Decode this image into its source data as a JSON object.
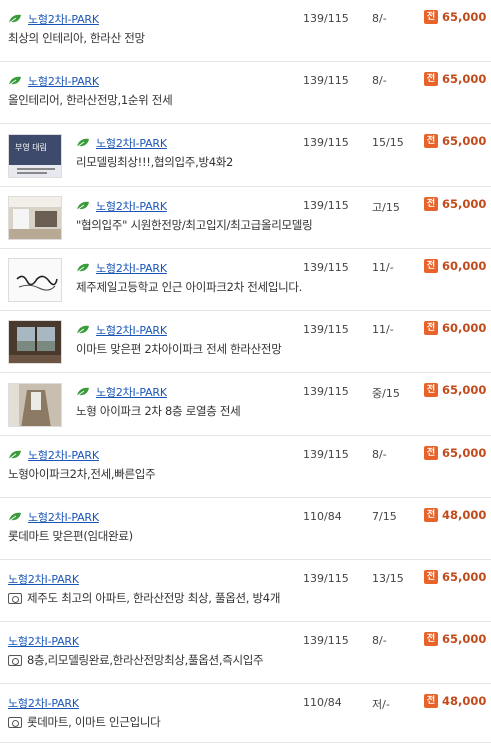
{
  "colors": {
    "link": "#1a56b8",
    "price": "#c24a1b",
    "badge": "#e8632a",
    "leaf": "#3a9b3a"
  },
  "badge_label": "전",
  "listings": [
    {
      "apt": "노형2차I-PARK",
      "desc": "최상의 인테리아, 한라산 전망",
      "area": "139/115",
      "floor": "8/-",
      "price": "65,000",
      "icon": "leaf-icon",
      "thumb": null,
      "photo_icon": false
    },
    {
      "apt": "노형2차I-PARK",
      "desc": "올인테리어, 한라산전망,1순위 전세",
      "area": "139/115",
      "floor": "8/-",
      "price": "65,000",
      "icon": "leaf-icon",
      "thumb": null,
      "photo_icon": false
    },
    {
      "apt": "노형2차I-PARK",
      "desc": "리모델링최상!!!,협의입주,방4화2",
      "area": "139/115",
      "floor": "15/15",
      "price": "65,000",
      "icon": "leaf-icon",
      "thumb": "office-sign",
      "thumb_text": "부영 대림",
      "photo_icon": false
    },
    {
      "apt": "노형2차I-PARK",
      "desc": "\"협의입주\" 시원한전망/최고입지/최고급올리모델링",
      "area": "139/115",
      "floor": "고/15",
      "price": "65,000",
      "icon": "leaf-icon",
      "thumb": "living-room",
      "photo_icon": false
    },
    {
      "apt": "노형2차I-PARK",
      "desc": "제주제일고등학교 인근 아이파크2차 전세입니다.",
      "area": "139/115",
      "floor": "11/-",
      "price": "60,000",
      "icon": "leaf-icon",
      "thumb": "calligraphy",
      "photo_icon": false
    },
    {
      "apt": "노형2차I-PARK",
      "desc": "이마트 맞은편 2차아이파크 전세 한라산전망",
      "area": "139/115",
      "floor": "11/-",
      "price": "60,000",
      "icon": "leaf-icon",
      "thumb": "window-view",
      "photo_icon": false
    },
    {
      "apt": "노형2차I-PARK",
      "desc": "노형 아이파크 2차 8층 로열층 전세",
      "area": "139/115",
      "floor": "중/15",
      "price": "65,000",
      "icon": "leaf-icon",
      "thumb": "hallway",
      "photo_icon": false
    },
    {
      "apt": "노형2차I-PARK",
      "desc": "노형아이파크2차,전세,빠른입주",
      "area": "139/115",
      "floor": "8/-",
      "price": "65,000",
      "icon": "leaf-icon",
      "thumb": null,
      "photo_icon": false
    },
    {
      "apt": "노형2차I-PARK",
      "desc": "롯데마트 맞은편(임대완료)",
      "area": "110/84",
      "floor": "7/15",
      "price": "48,000",
      "icon": "leaf-icon",
      "thumb": null,
      "photo_icon": false
    },
    {
      "apt": "노형2차I-PARK",
      "desc": "제주도 최고의 아파트, 한라산전망 최상, 풀옵션, 방4개",
      "area": "139/115",
      "floor": "13/15",
      "price": "65,000",
      "icon": null,
      "thumb": null,
      "photo_icon": true
    },
    {
      "apt": "노형2차I-PARK",
      "desc": "8층,리모델링완료,한라산전망최상,풀옵션,즉시입주",
      "area": "139/115",
      "floor": "8/-",
      "price": "65,000",
      "icon": null,
      "thumb": null,
      "photo_icon": true
    },
    {
      "apt": "노형2차I-PARK",
      "desc": "롯데마트, 이마트 인근입니다",
      "area": "110/84",
      "floor": "저/-",
      "price": "48,000",
      "icon": null,
      "thumb": null,
      "photo_icon": true
    }
  ]
}
